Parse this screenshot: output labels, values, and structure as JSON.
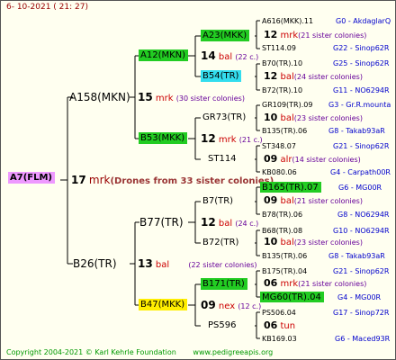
{
  "date": "6- 10-2021 ( 21: 27)",
  "root": {
    "name": "A7(FLM)",
    "num": "17",
    "race": "mrk",
    "sisters": "(Drones from 33 sister colonies)"
  },
  "sire": {
    "name": "A158(MKN)",
    "num": "15",
    "race": "mrk",
    "sisters": "(30 sister colonies)"
  },
  "dam": {
    "name": "B26(TR)",
    "num": "13",
    "race": "bal",
    "sisters": "(22 sister colonies)"
  },
  "sire_sire": {
    "name": "A12(MKN)",
    "num": "14",
    "race": "bal",
    "sisters": "(22 c.)"
  },
  "sire_dam": {
    "name": "B53(MKK)",
    "num": "12",
    "race": "mrk",
    "sisters": "(21 c.)"
  },
  "dam_sire": {
    "name": "B77(TR)",
    "num": "12",
    "race": "bal",
    "sisters": "(24 c.)"
  },
  "dam_dam": {
    "name": "B47(MKK)",
    "num": "09",
    "race": "nex",
    "sisters": "(12 c.)"
  },
  "g3": {
    "a23": {
      "name": "A23(MKK)",
      "num": "12",
      "race": "mrk",
      "sisters": "(21 sister colonies)"
    },
    "b54": {
      "name": "B54(TR)",
      "num": "12",
      "race": "bal",
      "sisters": "(24 sister colonies)"
    },
    "gr73": {
      "name": "GR73(TR)",
      "num": "10",
      "race": "bal",
      "sisters": "(23 sister colonies)"
    },
    "st114": {
      "name": "ST114",
      "num": "09",
      "race": "alr",
      "sisters": "(14 sister colonies)"
    },
    "b7": {
      "name": "B7(TR)",
      "num": "09",
      "race": "bal",
      "sisters": "(21 sister colonies)"
    },
    "b72": {
      "name": "B72(TR)",
      "num": "10",
      "race": "bal",
      "sisters": "(23 sister colonies)"
    },
    "b171": {
      "name": "B171(TR)",
      "num": "06",
      "race": "mrk",
      "sisters": "(21 sister colonies)"
    },
    "ps596": {
      "name": "PS596",
      "num": "06",
      "race": "tun",
      "sisters": ""
    }
  },
  "g4": [
    {
      "name": "A616(MKK).11",
      "code": "G0 - AkdaglarQ"
    },
    {
      "name": "ST114.09",
      "code": "G22 - Sinop62R"
    },
    {
      "name": "B70(TR).10",
      "code": "G25 - Sinop62R"
    },
    {
      "name": "B72(TR).10",
      "code": "G11 - NO6294R"
    },
    {
      "name": "GR109(TR).09",
      "code": "G3 - Gr.R.mounta"
    },
    {
      "name": "B135(TR).06",
      "code": "G8 - Takab93aR"
    },
    {
      "name": "ST348.07",
      "code": "G21 - Sinop62R"
    },
    {
      "name": "KB080.06",
      "code": "G4 - Carpath00R"
    },
    {
      "name": "B165(TR).07",
      "code": "G6 - MG00R"
    },
    {
      "name": "B78(TR).06",
      "code": "G8 - NO6294R"
    },
    {
      "name": "B68(TR).08",
      "code": "G10 - NO6294R"
    },
    {
      "name": "B135(TR).06",
      "code": "G8 - Takab93aR"
    },
    {
      "name": "B175(TR).04",
      "code": "G21 - Sinop62R"
    },
    {
      "name": "MG60(TR).04",
      "code": "G4 - MG00R"
    },
    {
      "name": "PS506.04",
      "code": "G17 - Sinop72R"
    },
    {
      "name": "KB169.03",
      "code": "G6 - Maced93R"
    }
  ],
  "footer": {
    "copyright": "Copyright 2004-2021 © Karl Kehrle Foundation",
    "url": "www.pedigreeapis.org"
  },
  "colors": {
    "line": "#000000",
    "green": "#22cc22",
    "cyan": "#33ddee",
    "yellow": "#ffee00",
    "pink": "#ee99ff"
  }
}
